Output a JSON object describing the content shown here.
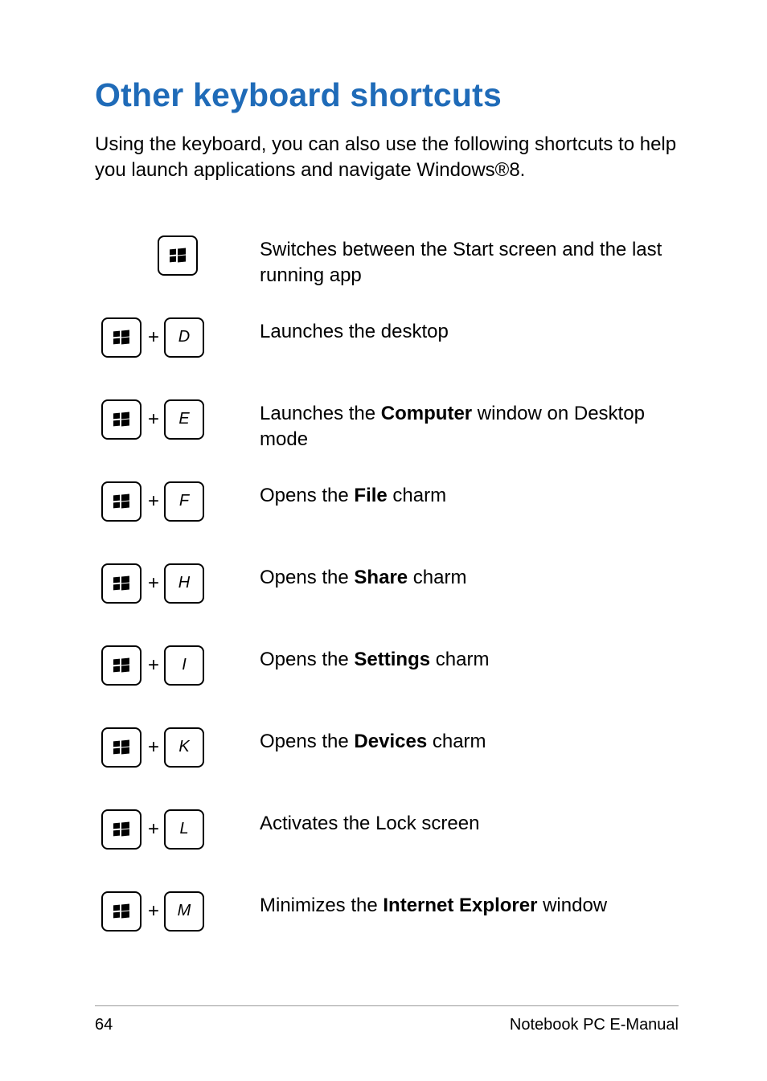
{
  "title": "Other keyboard shortcuts",
  "intro": "Using the keyboard, you can also use the following shortcuts to help you launch applications and navigate Windows®8.",
  "shortcuts": [
    {
      "keys": [
        "win"
      ],
      "desc_pre": "Switches between the Start screen and the last running app",
      "bold": "",
      "desc_post": ""
    },
    {
      "keys": [
        "win",
        "D"
      ],
      "desc_pre": "Launches the desktop",
      "bold": "",
      "desc_post": ""
    },
    {
      "keys": [
        "win",
        "E"
      ],
      "desc_pre": "Launches the ",
      "bold": "Computer",
      "desc_post": " window on Desktop mode"
    },
    {
      "keys": [
        "win",
        "F"
      ],
      "desc_pre": "Opens the ",
      "bold": "File",
      "desc_post": " charm"
    },
    {
      "keys": [
        "win",
        "H"
      ],
      "desc_pre": "Opens the ",
      "bold": "Share",
      "desc_post": " charm"
    },
    {
      "keys": [
        "win",
        "I"
      ],
      "desc_pre": "Opens the ",
      "bold": "Settings",
      "desc_post": " charm"
    },
    {
      "keys": [
        "win",
        "K"
      ],
      "desc_pre": "Opens the ",
      "bold": "Devices",
      "desc_post": " charm"
    },
    {
      "keys": [
        "win",
        "L"
      ],
      "desc_pre": "Activates the Lock screen",
      "bold": "",
      "desc_post": ""
    },
    {
      "keys": [
        "win",
        "M"
      ],
      "desc_pre": "Minimizes the ",
      "bold": "Internet Explorer",
      "desc_post": " window"
    }
  ],
  "footer": {
    "page": "64",
    "label": "Notebook PC E-Manual"
  }
}
